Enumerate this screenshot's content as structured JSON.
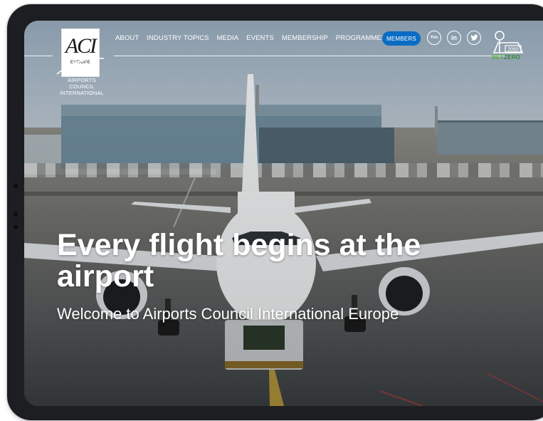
{
  "header": {
    "logo": {
      "mark": "ACI",
      "badge": "EUROPE",
      "caption": [
        "AIRPORTS COUNCIL",
        "INTERNATIONAL"
      ]
    },
    "nav": [
      "ABOUT",
      "INDUSTRY TOPICS",
      "MEDIA",
      "EVENTS",
      "MEMBERSHIP",
      "PROGRAMMES"
    ],
    "members_button": "MEMBERS",
    "social": {
      "youtube": "You",
      "linkedin": "in",
      "twitter": "twitter-bird-icon"
    },
    "netzero": {
      "year": "2050",
      "net": "NET",
      "zero": "ZERO"
    }
  },
  "hero": {
    "title": "Every flight begins at the airport",
    "subtitle": "Welcome to Airports Council International Europe"
  },
  "colors": {
    "accent": "#0b6cc4",
    "netzero_green": "#5fb03a",
    "frame": "#1d1e21"
  }
}
